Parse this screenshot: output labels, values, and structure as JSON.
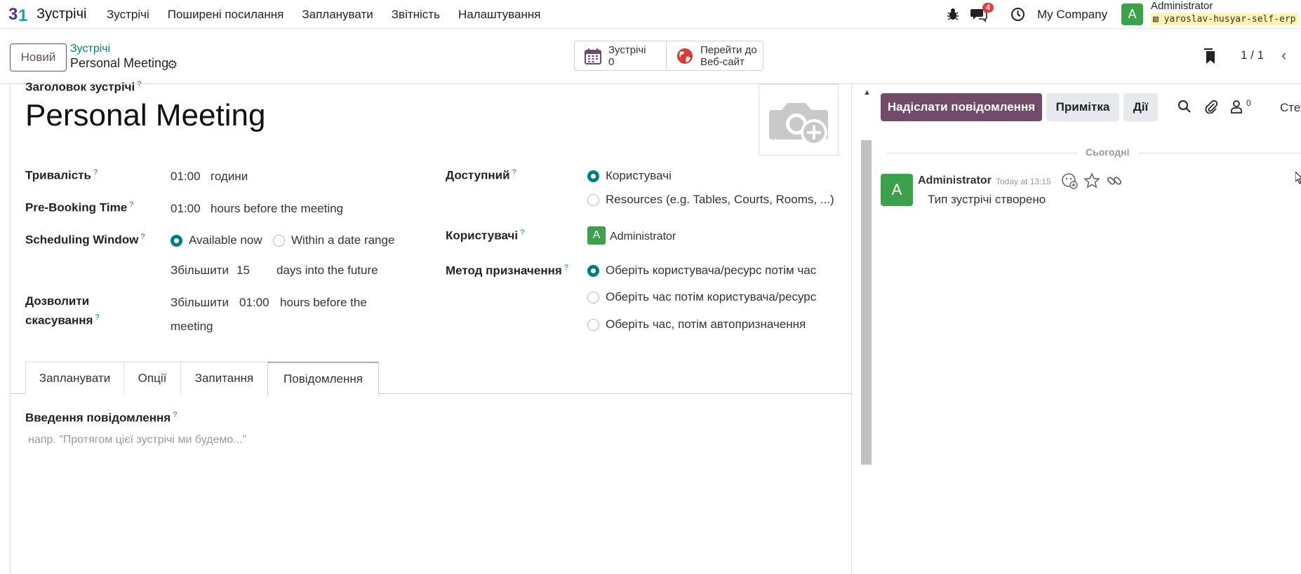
{
  "topbar": {
    "app_name": "Зустрічі",
    "menu": [
      "Зустрічі",
      "Поширені посилання",
      "Запланувати",
      "Звітність",
      "Налаштування"
    ],
    "messages_badge": "4",
    "company": "My Company",
    "user_initial": "A",
    "user_name": "Administrator",
    "database": "yaroslav-husyar-self-erp"
  },
  "control": {
    "new_button": "Новий",
    "breadcrumb_parent": "Зустрічі",
    "breadcrumb_current": "Personal Meeting",
    "smart_meetings_label": "Зустрічі",
    "smart_meetings_count": "0",
    "smart_website_line1": "Перейти до",
    "smart_website_line2": "Веб-сайт",
    "pager": "1 / 1"
  },
  "form": {
    "title_label": "Заголовок зустрічі",
    "title": "Personal Meeting",
    "duration_label": "Тривалість",
    "duration_value": "01:00",
    "duration_unit": "години",
    "prebooking_label": "Pre-Booking Time",
    "prebooking_value": "01:00",
    "prebooking_unit": "hours before the meeting",
    "window_label": "Scheduling Window",
    "window_opt1": "Available now",
    "window_opt2": "Within a date range",
    "window_increase": "Збільшити",
    "window_days": "15",
    "window_days_unit": "days into the future",
    "cancel_label_1": "Дозволити",
    "cancel_label_2": "скасування",
    "cancel_increase": "Збільшити",
    "cancel_value": "01:00",
    "cancel_unit_1": "hours before the",
    "cancel_unit_2": "meeting",
    "available_label": "Доступний",
    "available_opt1": "Користувачі",
    "available_opt2": "Resources (e.g. Tables, Courts, Rooms, ...)",
    "users_label": "Користувачі",
    "users_initial": "A",
    "users_value": "Administrator",
    "assign_label": "Метод призначення",
    "assign_opt1": "Оберіть користувача/ресурс потім час",
    "assign_opt2": "Оберіть час потім користувача/ресурс",
    "assign_opt3": "Оберіть час, потім автопризначення",
    "help_mark": "?"
  },
  "tabs": [
    "Запланувати",
    "Опції",
    "Запитання",
    "Повідомлення"
  ],
  "message_tab": {
    "label": "Введення повідомлення",
    "placeholder": "напр. \"Протягом цієї зустрічі ми будемо...\""
  },
  "chatter": {
    "send_button": "Надіслати повідомлення",
    "note_button": "Примітка",
    "actions_button": "Дії",
    "followers_count": "0",
    "follow_text": "Стежити",
    "today": "Сьогодні",
    "author_initial": "A",
    "author": "Administrator",
    "time": "Today at 13:15",
    "message": "Тип зустрічі створено"
  },
  "colors": {
    "primary": "#714b67",
    "accent": "#017e84",
    "avatar": "#3da14b"
  }
}
